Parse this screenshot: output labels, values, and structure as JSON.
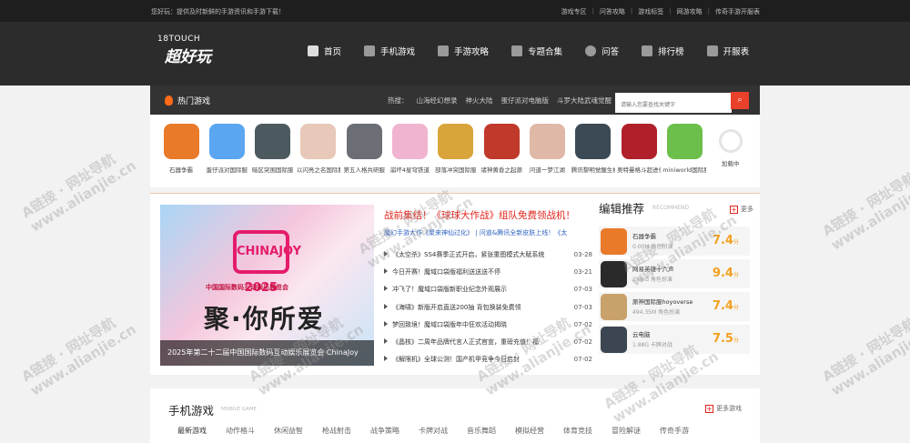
{
  "topbar": {
    "welcome": "您好玩：提供及时新鲜的手游资讯和手游下载！",
    "links": [
      "游戏专区",
      "问答攻略",
      "游戏标签",
      "网游攻略",
      "传奇手游开服表"
    ]
  },
  "nav": {
    "items": [
      {
        "label": "首页",
        "icon": "home-icon"
      },
      {
        "label": "手机游戏",
        "icon": "gamepad-icon"
      },
      {
        "label": "手游攻略",
        "icon": "book-icon"
      },
      {
        "label": "专题合集",
        "icon": "collection-icon"
      },
      {
        "label": "问答",
        "icon": "question-icon"
      },
      {
        "label": "排行榜",
        "icon": "crown-icon"
      },
      {
        "label": "开服表",
        "icon": "server-icon"
      }
    ]
  },
  "logo": {
    "line1": "18TOUCH",
    "line2": "超好玩"
  },
  "hot": {
    "title": "热门游戏",
    "searches_label": "热搜：",
    "searches": [
      "山海经幻想录",
      "神火大陆",
      "蛋仔派对电脑版",
      "斗罗大陆武魂觉醒"
    ],
    "search_placeholder": "请输入您要查找关键字",
    "games": [
      {
        "name": "石器争霸",
        "color": "#e87a2a"
      },
      {
        "name": "蛋仔派对国际服",
        "color": "#5aa6f0"
      },
      {
        "name": "暗区突围国际服",
        "color": "#4c5a5f"
      },
      {
        "name": "以闪亮之名国际服",
        "color": "#e8c8b8"
      },
      {
        "name": "第五人格共研服",
        "color": "#6b6f75"
      },
      {
        "name": "崩坏4星穹铁道",
        "color": "#f0b4d0"
      },
      {
        "name": "部落冲突国际服",
        "color": "#d9a53a"
      },
      {
        "name": "诸神黄昏之起源",
        "color": "#c0392b"
      },
      {
        "name": "问道一梦江湖",
        "color": "#e0b8a8"
      },
      {
        "name": "腾讯黎明觉醒生机",
        "color": "#3b4a55"
      },
      {
        "name": "奥特曼格斗超进化",
        "color": "#b0202a"
      },
      {
        "name": "miniworld国际服",
        "color": "#6cbf4a"
      },
      {
        "name": "加载中",
        "color": "#eeeeee"
      }
    ]
  },
  "news": {
    "banner_caption": "2025年第二十二届中国国际数码互动娱乐展览会 ChinaJoy",
    "banner_big": "聚·你所爱",
    "banner_logo": "CHINAJOY 2025",
    "banner_cn": "中国国际数码互动娱乐展览会",
    "headline": "战前集结！《球球大作战》组队免费领战机！",
    "subline": "魔幻手游大作《聚来神仙过化》 | 问道&腾讯全新皮肤上线！《太",
    "items": [
      {
        "title": "《太空杀》SS4赛季正式开启，紧张重图模式大赋系统",
        "date": "03-28"
      },
      {
        "title": "今日开赛！魔域口袋版福利送送送不停",
        "date": "03-21"
      },
      {
        "title": "冲飞了！魔域口袋版新职业纪念外观展示",
        "date": "07-03"
      },
      {
        "title": "《海啸》新版开启直送200抽 背包换装免费领",
        "date": "07-03"
      },
      {
        "title": "梦回致境！魔域口袋版年中狂欢活动揭晓",
        "date": "07-02"
      },
      {
        "title": "《晶核》二周年品牌代言人正式官宣，重磅充值！福",
        "date": "07-02"
      },
      {
        "title": "《解限机》全球公测！国产机甲竞争今日启封",
        "date": "07-02"
      }
    ]
  },
  "editor": {
    "title": "编辑推荐",
    "subtitle": "RECOMMEND",
    "more": "更多",
    "items": [
      {
        "name": "石器争霸",
        "meta": "0.00M 角色扮演",
        "score": "7.4",
        "unit": "分",
        "color": "#e87a2a"
      },
      {
        "name": "网易英雄十六声",
        "meta": "1.06G 角色扮演",
        "score": "9.4",
        "unit": "分",
        "color": "#2a2a2a"
      },
      {
        "name": "原神国际服hoyoverse",
        "meta": "494.35M 角色扮演",
        "score": "7.4",
        "unit": "分",
        "color": "#c9a26b"
      },
      {
        "name": "云电脑",
        "meta": "1.88G 卡牌对战",
        "score": "7.5",
        "unit": "分",
        "color": "#3c4652"
      }
    ]
  },
  "mobile": {
    "title": "手机游戏",
    "subtitle": "MOBILE GAME",
    "more": "更多游戏",
    "tabs": [
      "最新游戏",
      "动作格斗",
      "休闲益智",
      "枪战射击",
      "战争策略",
      "卡牌对战",
      "音乐舞蹈",
      "模拟经营",
      "体育竞技",
      "冒险解谜",
      "传奇手游"
    ]
  },
  "watermark": {
    "line1": "A链接 · 网址导航",
    "line2": "www.alianjie.cn"
  }
}
